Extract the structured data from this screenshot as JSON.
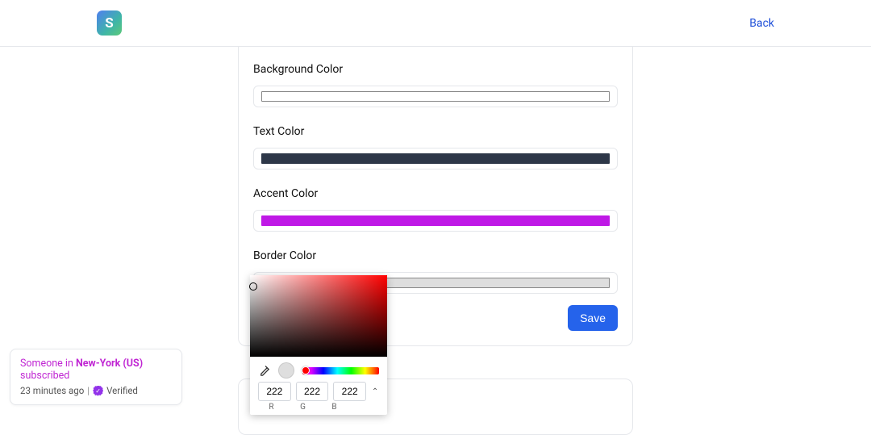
{
  "header": {
    "back_label": "Back",
    "logo_letter": "S"
  },
  "fields": {
    "background": {
      "label": "Background Color",
      "color": "#ffffff"
    },
    "text": {
      "label": "Text Color",
      "color": "#2d3748"
    },
    "accent": {
      "label": "Accent Color",
      "color": "#bf19e6"
    },
    "border": {
      "label": "Border Color",
      "color": "#dedede"
    }
  },
  "save_label": "Save",
  "picker": {
    "r": "222",
    "g": "222",
    "b": "222",
    "r_label": "R",
    "g_label": "G",
    "b_label": "B",
    "preview": "#dedede"
  },
  "toast": {
    "prefix": "Someone in ",
    "location": "New-York (US)",
    "suffix": " subscribed",
    "time": "23 minutes ago",
    "verified_label": "Verified"
  }
}
